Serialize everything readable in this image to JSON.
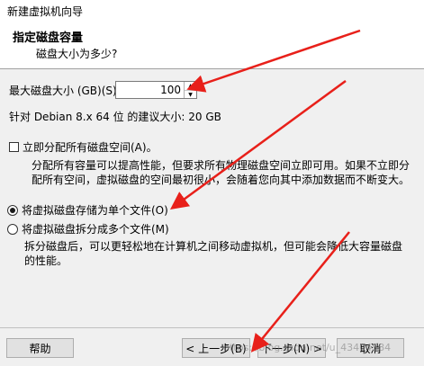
{
  "window": {
    "title": "新建虚拟机向导"
  },
  "header": {
    "title": "指定磁盘容量",
    "subtitle": "磁盘大小为多少?"
  },
  "disk": {
    "label": "最大磁盘大小 (GB)(S):",
    "value": "100",
    "recommend": "针对 Debian 8.x 64 位 的建议大小: 20 GB"
  },
  "allocate": {
    "label": "立即分配所有磁盘空间(A)。",
    "checked": false,
    "description": "分配所有容量可以提高性能，但要求所有物理磁盘空间立即可用。如果不立即分配所有空间，虚拟磁盘的空间最初很小，会随着您向其中添加数据而不断变大。"
  },
  "options": [
    {
      "label": "将虚拟磁盘存储为单个文件(O)",
      "checked": true
    },
    {
      "label": "将虚拟磁盘拆分成多个文件(M)",
      "checked": false
    }
  ],
  "split_description": "拆分磁盘后，可以更轻松地在计算机之间移动虚拟机，但可能会降低大容量磁盘的性能。",
  "buttons": {
    "help": "帮助",
    "back": "< 上一步(B)",
    "next": "下一步(N) >",
    "cancel": "取消"
  },
  "watermark": "https://blog.csdn.net/u_43404584",
  "annotation_color": "#e8201a"
}
